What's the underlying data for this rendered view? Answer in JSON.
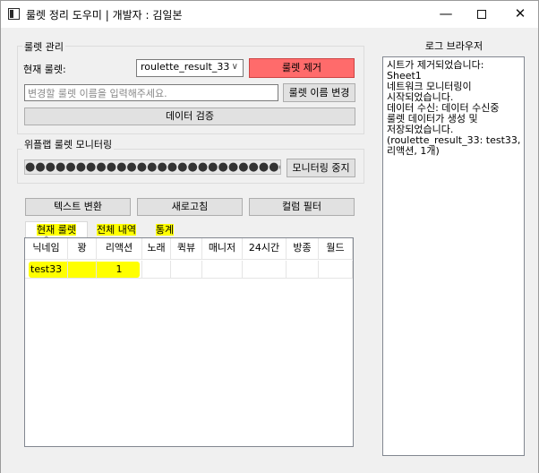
{
  "window": {
    "title": "룰렛 정리 도우미 | 개발자 : 김일본",
    "min_glyph": "—",
    "close_glyph": "✕"
  },
  "roulette_group": {
    "title": "룰렛 관리",
    "current_label": "현재 룰렛:",
    "combo_value": "roulette_result_33",
    "combo_arrow": "∨",
    "remove_button": "룰렛 제거",
    "rename_placeholder": "변경할 룰렛 이름을 입력해주세요.",
    "rename_button": "룰렛 이름 변경",
    "validate_button": "데이터 검증",
    "remove_color": "#ff6b6b"
  },
  "monitor_group": {
    "title": "위플랩 룰렛 모니터링",
    "dots": "●●●●●●●●●●●●●●●●●●●●●●●●●●●",
    "stop_button": "모니터링 중지"
  },
  "toolbar": {
    "text_convert": "텍스트 변환",
    "refresh": "새로고침",
    "column_filter": "컬럼 필터"
  },
  "tabs": [
    {
      "label": "현재 룰렛",
      "active": true
    },
    {
      "label": "전체 내역",
      "active": false
    },
    {
      "label": "통계",
      "active": false
    }
  ],
  "table": {
    "sort_glyph": "^",
    "columns": [
      "닉네임",
      "꽝",
      "리액션",
      "노래",
      "퀵뷰",
      "매니저",
      "24시간",
      "방종",
      "월드"
    ],
    "rows": [
      [
        "test33",
        "",
        "1",
        "",
        "",
        "",
        "",
        "",
        ""
      ]
    ]
  },
  "log": {
    "title": "로그 브라우저",
    "lines": [
      "시트가 제거되었습니다:",
      "Sheet1",
      "네트워크 모니터링이",
      "시작되었습니다.",
      "데이터 수신: 데이터 수신중",
      "룰렛 데이터가 생성 및",
      "저장되었습니다.",
      "(roulette_result_33: test33,",
      "리액션, 1개)"
    ]
  },
  "highlight_color": "#ffff00"
}
